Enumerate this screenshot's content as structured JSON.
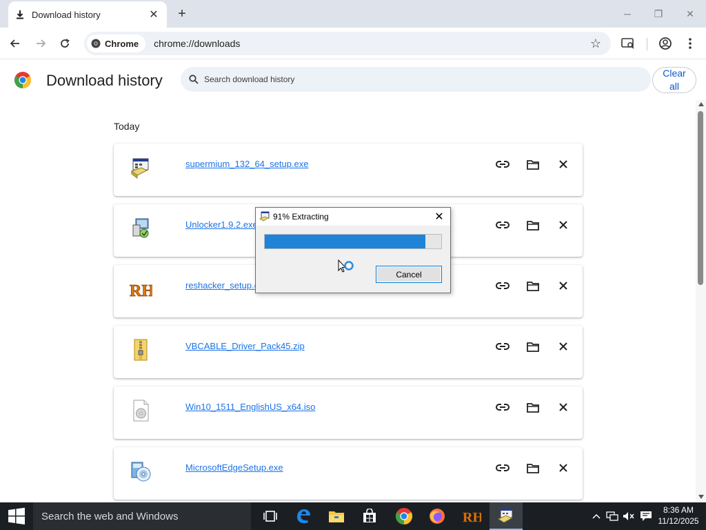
{
  "browser": {
    "tab_title": "Download history",
    "chip_label": "Chrome",
    "url": "chrome://downloads"
  },
  "downloads": {
    "title": "Download history",
    "search_placeholder": "Search download history",
    "clear_all_line1": "Clear",
    "clear_all_line2": "all",
    "section_label": "Today",
    "items": [
      {
        "filename": "supermium_132_64_setup.exe",
        "icon": "installer-icon"
      },
      {
        "filename": "Unlocker1.9.2.exe",
        "icon": "unlocker-icon"
      },
      {
        "filename": "reshacker_setup.exe",
        "icon": "reshacker-icon"
      },
      {
        "filename": "VBCABLE_Driver_Pack45.zip",
        "icon": "zip-archive-icon"
      },
      {
        "filename": "Win10_1511_EnglishUS_x64.iso",
        "icon": "disc-image-icon"
      },
      {
        "filename": "MicrosoftEdgeSetup.exe",
        "icon": "setup-disc-icon"
      }
    ]
  },
  "dialog": {
    "title": "91% Extracting",
    "progress": 0.91,
    "cancel_label": "Cancel"
  },
  "taskbar": {
    "search_placeholder": "Search the web and Windows",
    "time": "8:36 AM",
    "date": "11/12/2025"
  },
  "colors": {
    "link": "#1a73e8",
    "accent": "#0b57d0",
    "progress": "#1f83d8",
    "taskbar": "#1b1f24"
  }
}
